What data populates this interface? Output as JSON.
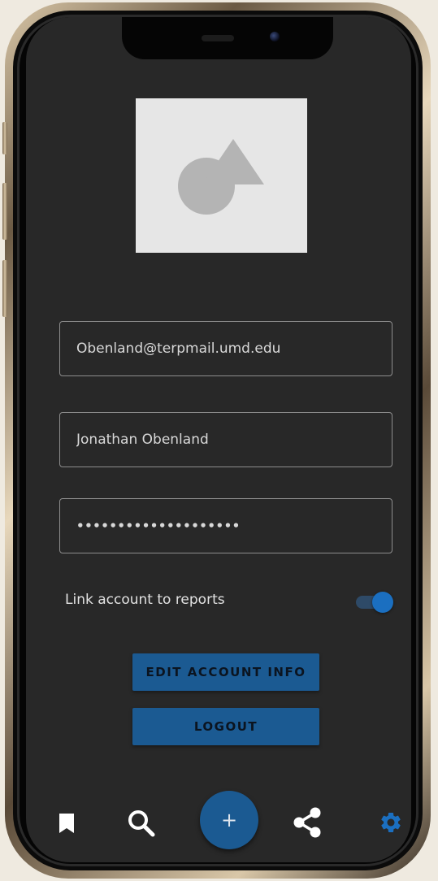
{
  "form": {
    "email_value": "Obenland@terpmail.umd.edu",
    "name_value": "Jonathan Obenland",
    "password_value": "••••••••••••••••••••"
  },
  "toggle": {
    "label": "Link account to reports",
    "state": "on"
  },
  "buttons": {
    "edit_label": "EDIT ACCOUNT INFO",
    "logout_label": "LOGOUT"
  },
  "nav": {
    "fab_label": "+",
    "items": [
      {
        "icon": "bookmark-icon",
        "active": false
      },
      {
        "icon": "search-icon",
        "active": false
      },
      {
        "icon": "add-icon",
        "active": false
      },
      {
        "icon": "share-icon",
        "active": false
      },
      {
        "icon": "gear-icon",
        "active": true
      }
    ]
  },
  "colors": {
    "screen_background": "#282828",
    "accent": "#1b5a92",
    "active_icon": "#1b6fc0",
    "inactive_icon": "#ffffff",
    "placeholder_background": "#e6e6e6",
    "placeholder_shapes": "#b4b4b4"
  }
}
